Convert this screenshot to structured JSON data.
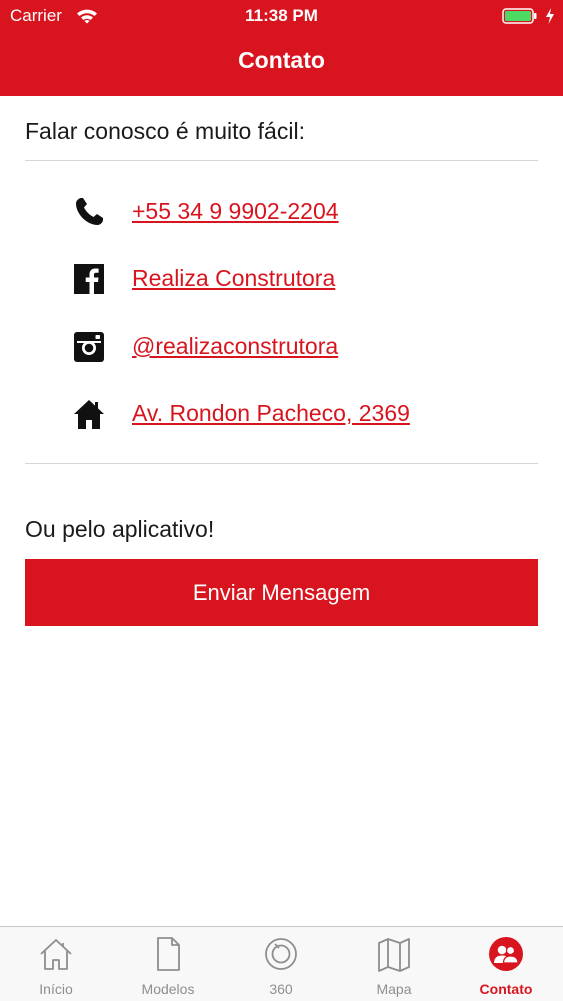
{
  "status_bar": {
    "carrier": "Carrier",
    "time": "11:38 PM"
  },
  "nav": {
    "title": "Contato"
  },
  "contact": {
    "heading": "Falar conosco é muito fácil:",
    "items": [
      {
        "icon": "phone-icon",
        "label": "+55 34 9 9902-2204"
      },
      {
        "icon": "facebook-icon",
        "label": "Realiza Construtora"
      },
      {
        "icon": "instagram-icon",
        "label": "@realizaconstrutora"
      },
      {
        "icon": "home-icon",
        "label": "Av. Rondon Pacheco, 2369"
      }
    ]
  },
  "app": {
    "heading": "Ou pelo aplicativo!",
    "button_label": "Enviar Mensagem"
  },
  "tabs": [
    {
      "label": "Início",
      "icon": "home-outline-icon",
      "active": false
    },
    {
      "label": "Modelos",
      "icon": "document-icon",
      "active": false
    },
    {
      "label": "360",
      "icon": "camera-360-icon",
      "active": false
    },
    {
      "label": "Mapa",
      "icon": "map-icon",
      "active": false
    },
    {
      "label": "Contato",
      "icon": "contacts-icon",
      "active": true
    }
  ],
  "colors": {
    "brand": "#d8151f",
    "tab_inactive": "#8e8e8e"
  }
}
